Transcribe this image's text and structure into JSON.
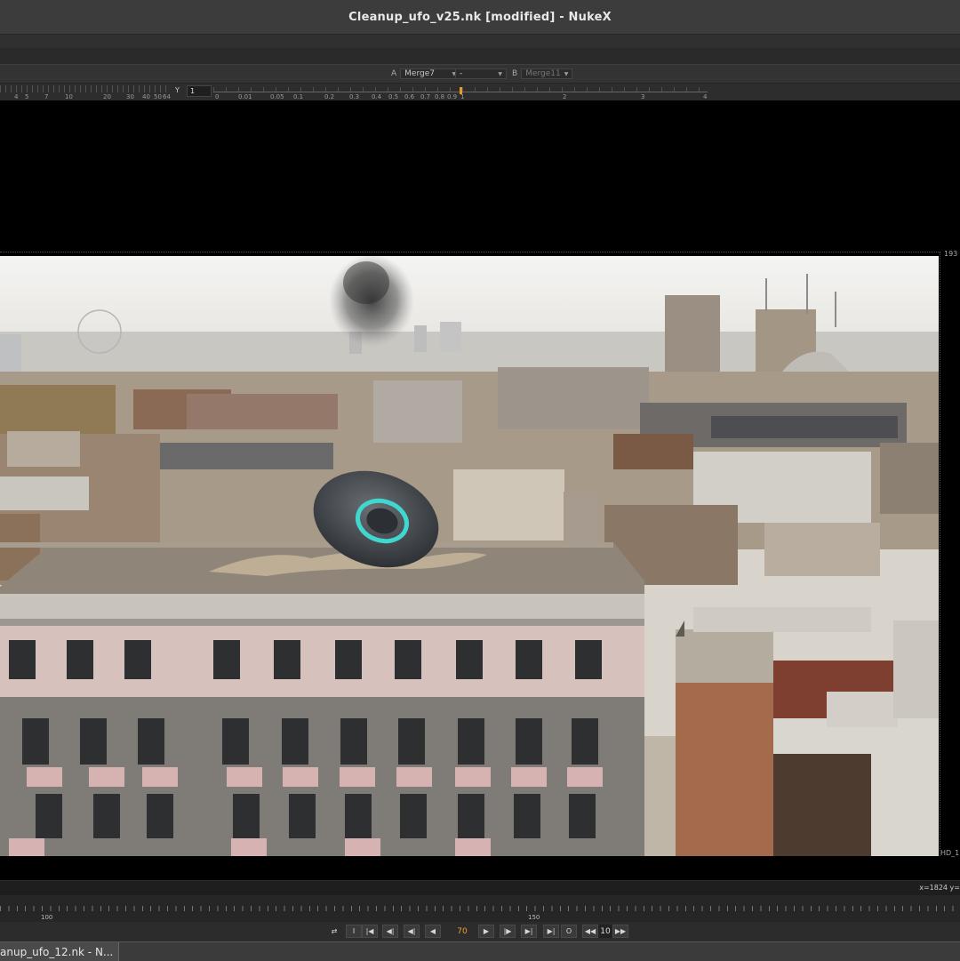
{
  "window": {
    "title": "Cleanup_ufo_v25.nk [modified] - NukeX"
  },
  "viewer_inputs": {
    "a_label": "A",
    "a_value": "Merge7",
    "op_value": "-",
    "b_label": "B",
    "b_value": "Merge11"
  },
  "gamma_bar": {
    "left_ticks": [
      "4",
      "5",
      "7",
      "10",
      "20",
      "30",
      "40",
      "50",
      "64"
    ],
    "y_label": "Y",
    "y_value": "1",
    "right_ticks": [
      "0",
      "0.01",
      "0.05",
      "0.1",
      "0.2",
      "0.3",
      "0.4",
      "0.5",
      "0.6",
      "0.7",
      "0.8",
      "0.9",
      "1",
      "2",
      "3",
      "4"
    ]
  },
  "viewer": {
    "top_right_label": "193",
    "bottom_right_label": "HD_1",
    "coordinate_readout": "x=1824 y="
  },
  "timeline": {
    "marks": [
      "100",
      "150"
    ]
  },
  "transport": {
    "buttons": [
      "⇄",
      "I",
      "|◀",
      "◀|",
      "◀|",
      "◀",
      "▶",
      "|▶",
      "▶|",
      "▶|",
      "O",
      "◀◀"
    ],
    "current_frame": "70",
    "increment": "10",
    "increment_next": "▶▶"
  },
  "taskbar": {
    "item_label": "anup_ufo_12.nk - N..."
  },
  "colors": {
    "accent_orange": "#f0a030",
    "ufo_ring": "#3fd7cf"
  }
}
